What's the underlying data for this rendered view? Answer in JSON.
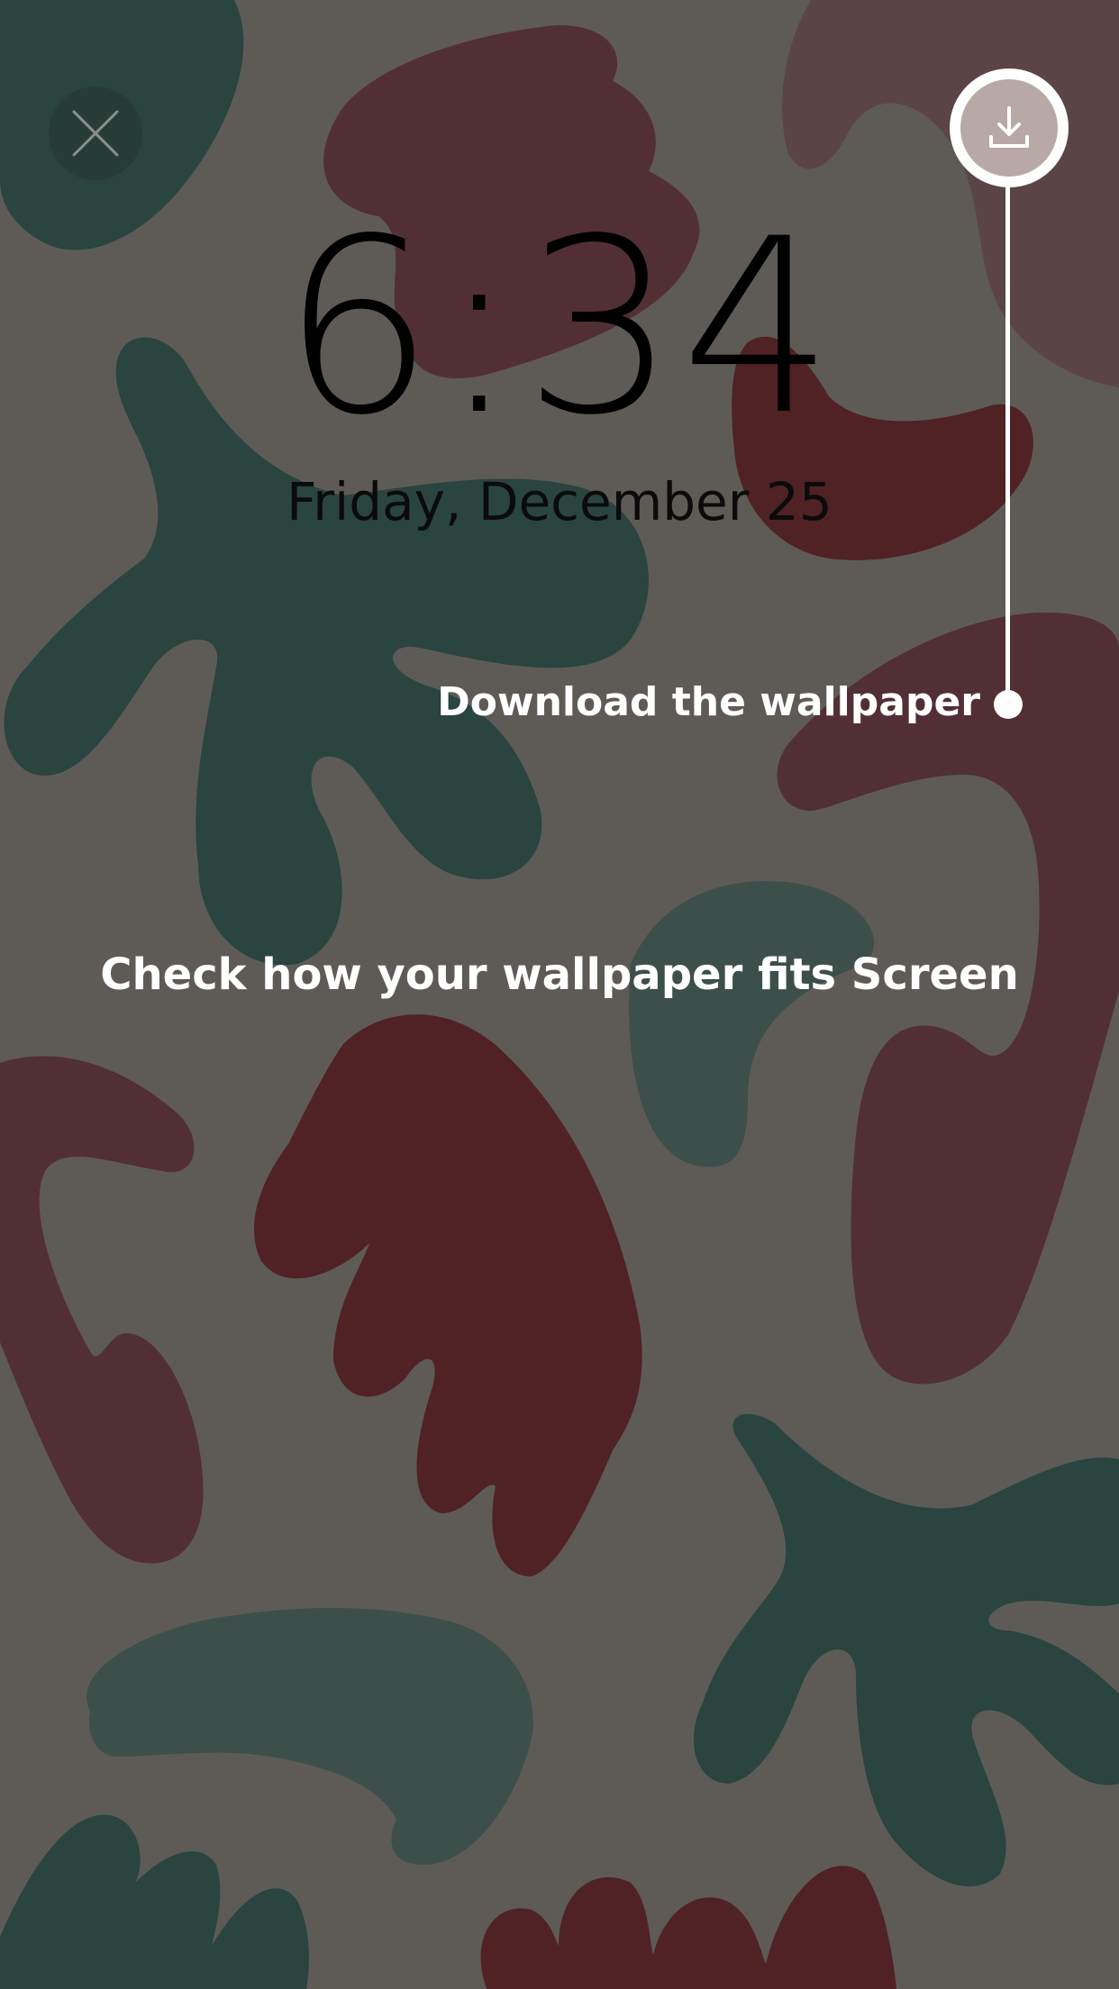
{
  "lockscreen": {
    "time": "6:34",
    "date": "Friday, December 25"
  },
  "controls": {
    "close_icon": "close-icon",
    "download_icon": "download-icon"
  },
  "callout": {
    "label": "Download the wallpaper"
  },
  "hint": {
    "text": "Check how your wallpaper fits Screen"
  },
  "colors": {
    "background": "#5e5b57",
    "dark_green": "#2a4440",
    "muted_green": "#3d4f4a",
    "plum": "#522f35",
    "dark_red": "#502224",
    "accent_white": "#ffffff"
  }
}
